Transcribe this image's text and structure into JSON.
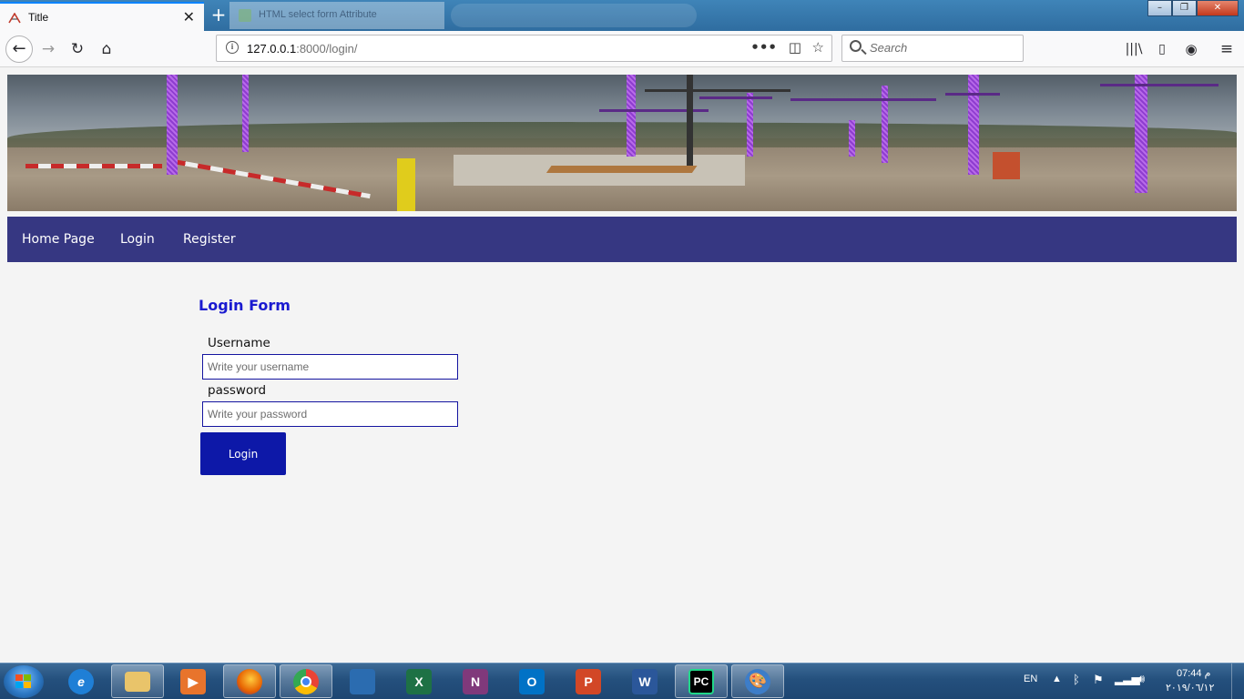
{
  "browser": {
    "active_tab_title": "Title",
    "tab_close": "✕",
    "new_tab": "+",
    "inactive_tab_title": "HTML select form Attribute",
    "url_host": "127.0.0.1",
    "url_path": ":8000/login/",
    "search_placeholder": "Search",
    "window_buttons": [
      "–",
      "❐",
      "✕"
    ]
  },
  "site": {
    "nav": [
      "Home Page",
      "Login",
      "Register"
    ]
  },
  "form": {
    "title": "Login Form",
    "username_label": "Username",
    "username_placeholder": "Write your username",
    "password_label": "password",
    "password_placeholder": "Write your password",
    "submit_label": "Login"
  },
  "taskbar": {
    "apps": [
      {
        "name": "internet-explorer",
        "glyph": "e",
        "color": "#1f7fd6"
      },
      {
        "name": "file-explorer",
        "glyph": "",
        "color": "#e9c46a"
      },
      {
        "name": "media-player",
        "glyph": "▶",
        "color": "#e8742c"
      },
      {
        "name": "firefox",
        "glyph": "",
        "color": "#e66000"
      },
      {
        "name": "chrome",
        "glyph": "",
        "color": "#34a853"
      },
      {
        "name": "network-app",
        "glyph": "",
        "color": "#2b6cb0"
      },
      {
        "name": "excel",
        "glyph": "X",
        "color": "#1e7145"
      },
      {
        "name": "onenote",
        "glyph": "N",
        "color": "#80397b"
      },
      {
        "name": "outlook",
        "glyph": "O",
        "color": "#0072c6"
      },
      {
        "name": "powerpoint",
        "glyph": "P",
        "color": "#d24726"
      },
      {
        "name": "word",
        "glyph": "W",
        "color": "#2b579a"
      },
      {
        "name": "pycharm",
        "glyph": "PC",
        "color": "#000000"
      },
      {
        "name": "paint",
        "glyph": "🎨",
        "color": "#3d7dc8"
      }
    ],
    "language": "EN",
    "time": "07:44 م",
    "date": "٢٠١٩/٠٦/١٢"
  },
  "colors": {
    "menu_bg": "#363782",
    "form_title": "#1a1ad0",
    "button_bg": "#0d18a8",
    "input_border": "#1414a0"
  }
}
